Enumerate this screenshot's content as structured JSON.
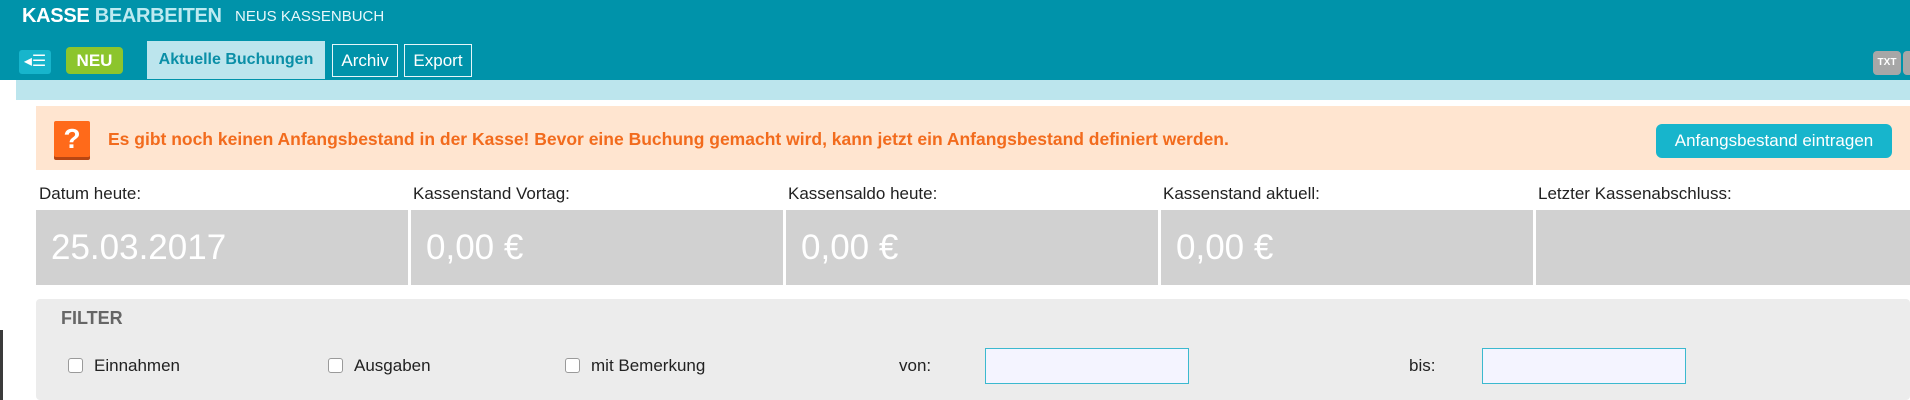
{
  "header": {
    "title_part1": "KASSE",
    "title_part2": "BEARBEITEN",
    "book_name": "NEUS KASSENBUCH",
    "back_icon": "back-list-icon",
    "back_symbol": "◂☰",
    "new_label": "NEU",
    "tabs": [
      {
        "label": "Aktuelle Buchungen",
        "active": true
      },
      {
        "label": "Archiv",
        "active": false
      },
      {
        "label": "Export",
        "active": false
      }
    ],
    "txt_label": "TXT"
  },
  "alert": {
    "icon_symbol": "?",
    "message": "Es gibt noch keinen Anfangsbestand in der Kasse! Bevor eine Buchung gemacht wird, kann jetzt ein Anfangsbestand definiert werden.",
    "button_label": "Anfangsbestand eintragen"
  },
  "stats": [
    {
      "label": "Datum heute:",
      "value": "25.03.2017"
    },
    {
      "label": "Kassenstand Vortag:",
      "value": "0,00 €"
    },
    {
      "label": "Kassensaldo heute:",
      "value": "0,00 €"
    },
    {
      "label": "Kassenstand aktuell:",
      "value": "0,00 €"
    },
    {
      "label": "Letzter Kassenabschluss:",
      "value": ""
    }
  ],
  "filter": {
    "title": "FILTER",
    "checkboxes": [
      {
        "label": "Einnahmen",
        "checked": false
      },
      {
        "label": "Ausgaben",
        "checked": false
      },
      {
        "label": "mit Bemerkung",
        "checked": false
      }
    ],
    "from_label": "von:",
    "from_value": "",
    "to_label": "bis:",
    "to_value": ""
  },
  "colors": {
    "header_bg": "#0093aa",
    "accent": "#17b5cc",
    "new_button": "#8cc52c",
    "warning_bg": "#ffe5d0",
    "warning_text": "#f26b1d",
    "stat_box": "#d1d1d1"
  }
}
